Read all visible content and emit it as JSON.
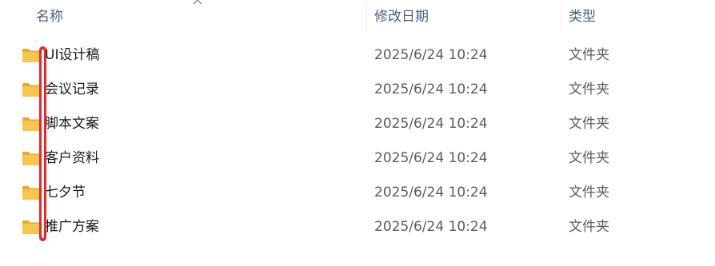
{
  "columns": {
    "name": "名称",
    "date": "修改日期",
    "type": "类型"
  },
  "sort": {
    "column": "name",
    "direction": "ascending",
    "icon": "chevron-up-icon"
  },
  "rows": [
    {
      "name": "UI设计稿",
      "date": "2025/6/24 10:24",
      "type": "文件夹",
      "icon": "folder-icon"
    },
    {
      "name": "会议记录",
      "date": "2025/6/24 10:24",
      "type": "文件夹",
      "icon": "folder-icon"
    },
    {
      "name": "脚本文案",
      "date": "2025/6/24 10:24",
      "type": "文件夹",
      "icon": "folder-icon"
    },
    {
      "name": "客户资料",
      "date": "2025/6/24 10:24",
      "type": "文件夹",
      "icon": "folder-icon"
    },
    {
      "name": "七夕节",
      "date": "2025/6/24 10:24",
      "type": "文件夹",
      "icon": "folder-icon"
    },
    {
      "name": "推广方案",
      "date": "2025/6/24 10:24",
      "type": "文件夹",
      "icon": "folder-icon"
    }
  ],
  "colors": {
    "folder": "#f6c64e",
    "folder_dark": "#e9a825",
    "annotation": "#e8262b",
    "header_text": "#4c607a"
  }
}
